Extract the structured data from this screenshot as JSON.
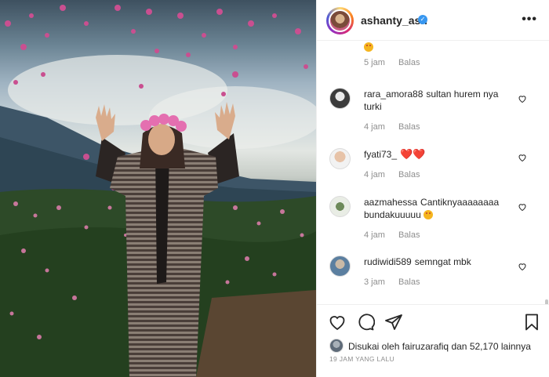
{
  "post": {
    "username": "ashanty_ash",
    "more_label": "•••"
  },
  "comments": [
    {
      "username": "",
      "text": "",
      "time": "5 jam",
      "reply": "Balas",
      "emoji": "grin-emoji"
    },
    {
      "username": "rara_amora88",
      "text": "sultan hurem nya turki",
      "time": "4 jam",
      "reply": "Balas"
    },
    {
      "username": "fyati73_",
      "text": "❤️❤️",
      "time": "4 jam",
      "reply": "Balas"
    },
    {
      "username": "aazmahessa",
      "text": "Cantiknyaaaaaaaa bundakuuuuu",
      "time": "4 jam",
      "reply": "Balas",
      "emoji": "heart-eyes-emoji"
    },
    {
      "username": "rudiwidi589",
      "text": "semngat mbk",
      "time": "3 jam",
      "reply": "Balas"
    }
  ],
  "likes": {
    "prefix": "Disukai oleh",
    "user": "fairuzarafiq",
    "connector": "dan",
    "count": "52,170",
    "suffix": "lainnya"
  },
  "time_ago": "19 JAM YANG LALU",
  "colors": {
    "verified": "#3897f0",
    "meta_text": "#8e8e8e",
    "heart_red": "#e0245e"
  }
}
